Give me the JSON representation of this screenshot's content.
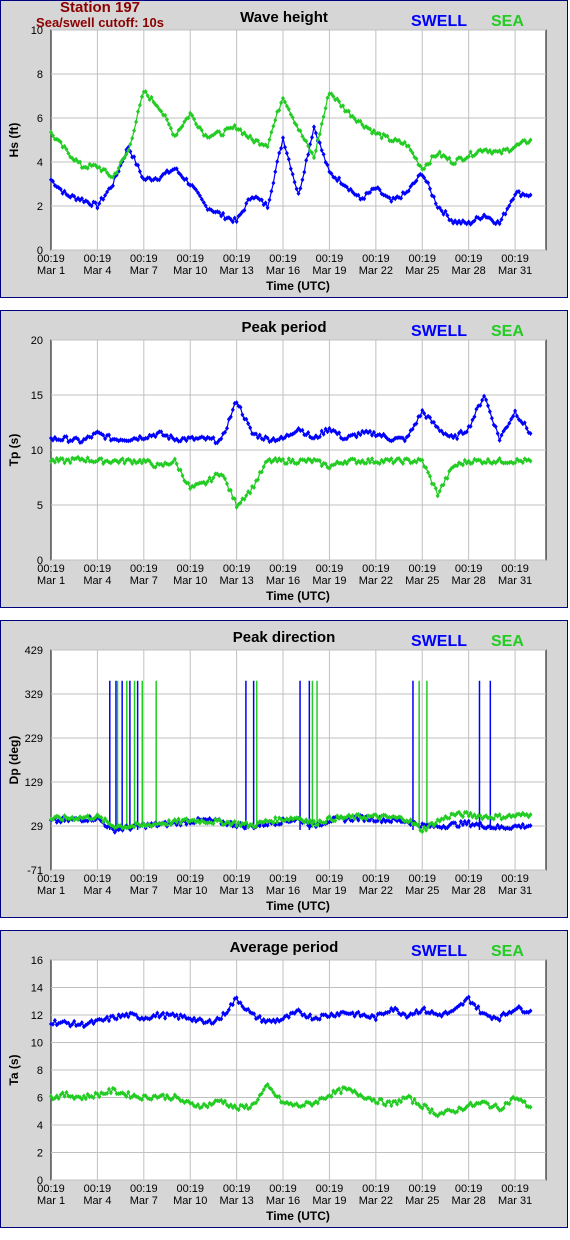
{
  "station": {
    "title": "Station 197",
    "subtitle": "Sea/swell cutoff: 10s"
  },
  "colors": {
    "swell": "#0000ff",
    "sea": "#22cc22",
    "frame_bg": "#d6d6d6",
    "border": "#00007f",
    "grid": "#c0c0c0"
  },
  "chart_data": [
    {
      "type": "line",
      "title": "Wave height",
      "ylabel": "Hs (ft)",
      "xlabel": "Time (UTC)",
      "ylim": [
        0,
        10
      ],
      "yticks": [
        "0",
        "2",
        "4",
        "6",
        "8",
        "10"
      ],
      "xticks": [
        [
          "00:19",
          "Mar 1"
        ],
        [
          "00:19",
          "Mar 4"
        ],
        [
          "00:19",
          "Mar 7"
        ],
        [
          "00:19",
          "Mar 10"
        ],
        [
          "00:19",
          "Mar 13"
        ],
        [
          "00:19",
          "Mar 16"
        ],
        [
          "00:19",
          "Mar 19"
        ],
        [
          "00:19",
          "Mar 22"
        ],
        [
          "00:19",
          "Mar 25"
        ],
        [
          "00:19",
          "Mar 28"
        ],
        [
          "00:19",
          "Mar 31"
        ]
      ],
      "legend": [
        "SWELL",
        "SEA"
      ],
      "x_days": [
        0,
        1,
        2,
        3,
        4,
        5,
        6,
        7,
        8,
        9,
        10,
        11,
        12,
        13,
        14,
        15,
        16,
        17,
        18,
        19,
        20,
        21,
        22,
        23,
        24,
        25,
        26,
        27,
        28,
        29,
        30,
        31
      ],
      "series": [
        {
          "name": "SWELL",
          "values": [
            3.2,
            2.5,
            2.3,
            2.0,
            3.0,
            4.7,
            3.2,
            3.3,
            3.7,
            3.0,
            2.0,
            1.6,
            1.3,
            2.5,
            2.0,
            5.1,
            2.5,
            5.6,
            3.5,
            3.0,
            2.3,
            2.8,
            2.2,
            2.6,
            3.5,
            2.0,
            1.3,
            1.2,
            1.6,
            1.2,
            2.6,
            2.5
          ]
        },
        {
          "name": "SEA",
          "values": [
            5.3,
            4.5,
            3.8,
            3.8,
            3.3,
            4.5,
            7.2,
            6.5,
            5.2,
            6.2,
            5.2,
            5.3,
            5.6,
            5.0,
            4.8,
            7.0,
            5.5,
            4.2,
            7.2,
            6.4,
            5.8,
            5.3,
            5.0,
            4.8,
            3.7,
            4.4,
            4.0,
            4.3,
            4.6,
            4.4,
            4.7,
            5.0
          ]
        }
      ]
    },
    {
      "type": "line",
      "title": "Peak period",
      "ylabel": "Tp (s)",
      "xlabel": "Time (UTC)",
      "ylim": [
        0,
        20
      ],
      "yticks": [
        "0",
        "5",
        "10",
        "15",
        "20"
      ],
      "xticks": [
        [
          "00:19",
          "Mar 1"
        ],
        [
          "00:19",
          "Mar 4"
        ],
        [
          "00:19",
          "Mar 7"
        ],
        [
          "00:19",
          "Mar 10"
        ],
        [
          "00:19",
          "Mar 13"
        ],
        [
          "00:19",
          "Mar 16"
        ],
        [
          "00:19",
          "Mar 19"
        ],
        [
          "00:19",
          "Mar 22"
        ],
        [
          "00:19",
          "Mar 25"
        ],
        [
          "00:19",
          "Mar 28"
        ],
        [
          "00:19",
          "Mar 31"
        ]
      ],
      "legend": [
        "SWELL",
        "SEA"
      ],
      "x_days": [
        0,
        1,
        2,
        3,
        4,
        5,
        6,
        7,
        8,
        9,
        10,
        11,
        12,
        13,
        14,
        15,
        16,
        17,
        18,
        19,
        20,
        21,
        22,
        23,
        24,
        25,
        26,
        27,
        28,
        29,
        30,
        31
      ],
      "series": [
        {
          "name": "SWELL",
          "values": [
            11.0,
            11.0,
            10.8,
            11.5,
            11.0,
            11.0,
            11.2,
            11.5,
            11.0,
            11.0,
            11.0,
            10.8,
            14.5,
            11.5,
            11.0,
            11.0,
            12.0,
            11.0,
            12.0,
            11.0,
            11.5,
            11.5,
            11.0,
            11.0,
            13.5,
            12.0,
            11.0,
            12.0,
            15.0,
            11.0,
            13.5,
            11.5
          ]
        },
        {
          "name": "SEA",
          "values": [
            9.0,
            9.0,
            9.2,
            9.0,
            9.0,
            9.0,
            9.0,
            8.5,
            9.0,
            6.5,
            7.0,
            8.0,
            5.0,
            6.5,
            9.0,
            9.0,
            9.0,
            9.0,
            8.5,
            9.0,
            9.0,
            9.0,
            9.0,
            9.0,
            9.0,
            6.0,
            8.5,
            9.0,
            9.0,
            9.0,
            9.0,
            9.0
          ]
        }
      ]
    },
    {
      "type": "line",
      "title": "Peak direction",
      "ylabel": "Dp (deg)",
      "xlabel": "Time (UTC)",
      "ylim": [
        -71,
        429
      ],
      "yticks": [
        "-71",
        "29",
        "129",
        "229",
        "329",
        "429"
      ],
      "xticks": [
        [
          "00:19",
          "Mar 1"
        ],
        [
          "00:19",
          "Mar 4"
        ],
        [
          "00:19",
          "Mar 7"
        ],
        [
          "00:19",
          "Mar 10"
        ],
        [
          "00:19",
          "Mar 13"
        ],
        [
          "00:19",
          "Mar 16"
        ],
        [
          "00:19",
          "Mar 19"
        ],
        [
          "00:19",
          "Mar 22"
        ],
        [
          "00:19",
          "Mar 25"
        ],
        [
          "00:19",
          "Mar 28"
        ],
        [
          "00:19",
          "Mar 31"
        ]
      ],
      "legend": [
        "SWELL",
        "SEA"
      ],
      "x_days": [
        0,
        1,
        2,
        3,
        4,
        5,
        6,
        7,
        8,
        9,
        10,
        11,
        12,
        13,
        14,
        15,
        16,
        17,
        18,
        19,
        20,
        21,
        22,
        23,
        24,
        25,
        26,
        27,
        28,
        29,
        30,
        31
      ],
      "series": [
        {
          "name": "SWELL",
          "values": [
            40,
            42,
            45,
            47,
            20,
            25,
            30,
            32,
            35,
            40,
            42,
            38,
            32,
            28,
            35,
            40,
            45,
            30,
            42,
            45,
            47,
            45,
            42,
            40,
            30,
            28,
            32,
            35,
            30,
            25,
            28,
            30
          ]
        },
        {
          "name": "SEA",
          "values": [
            45,
            47,
            48,
            50,
            30,
            28,
            30,
            35,
            38,
            42,
            40,
            38,
            35,
            30,
            40,
            45,
            48,
            35,
            45,
            48,
            50,
            50,
            48,
            45,
            20,
            40,
            55,
            55,
            50,
            50,
            52,
            55
          ]
        }
      ],
      "spikes": {
        "swell_days": [
          3.8,
          4.2,
          4.6,
          5.1,
          5.6,
          12.6,
          13.1,
          16.1,
          16.7,
          23.4,
          27.7,
          28.4
        ],
        "sea_days": [
          4.3,
          4.9,
          5.4,
          5.9,
          6.8,
          13.3,
          16.9,
          17.2,
          23.8,
          24.3
        ],
        "level": 359
      }
    },
    {
      "type": "line",
      "title": "Average period",
      "ylabel": "Ta (s)",
      "xlabel": "Time (UTC)",
      "ylim": [
        0,
        16
      ],
      "yticks": [
        "0",
        "2",
        "4",
        "6",
        "8",
        "10",
        "12",
        "14",
        "16"
      ],
      "xticks": [
        [
          "00:19",
          "Mar 1"
        ],
        [
          "00:19",
          "Mar 4"
        ],
        [
          "00:19",
          "Mar 7"
        ],
        [
          "00:19",
          "Mar 10"
        ],
        [
          "00:19",
          "Mar 13"
        ],
        [
          "00:19",
          "Mar 16"
        ],
        [
          "00:19",
          "Mar 19"
        ],
        [
          "00:19",
          "Mar 22"
        ],
        [
          "00:19",
          "Mar 25"
        ],
        [
          "00:19",
          "Mar 28"
        ],
        [
          "00:19",
          "Mar 31"
        ]
      ],
      "legend": [
        "SWELL",
        "SEA"
      ],
      "x_days": [
        0,
        1,
        2,
        3,
        4,
        5,
        6,
        7,
        8,
        9,
        10,
        11,
        12,
        13,
        14,
        15,
        16,
        17,
        18,
        19,
        20,
        21,
        22,
        23,
        24,
        25,
        26,
        27,
        28,
        29,
        30,
        31
      ],
      "series": [
        {
          "name": "SWELL",
          "values": [
            11.5,
            11.4,
            11.3,
            11.5,
            11.8,
            12.0,
            11.8,
            12.0,
            11.9,
            11.8,
            11.4,
            11.8,
            13.2,
            12.0,
            11.5,
            11.7,
            12.2,
            11.8,
            12.0,
            12.2,
            12.0,
            11.8,
            12.5,
            12.0,
            12.4,
            12.0,
            12.2,
            13.2,
            12.0,
            11.8,
            12.5,
            12.3
          ]
        },
        {
          "name": "SEA",
          "values": [
            6.0,
            6.2,
            6.0,
            6.2,
            6.5,
            6.2,
            6.0,
            6.1,
            6.0,
            5.5,
            5.4,
            5.8,
            5.2,
            5.4,
            6.8,
            5.6,
            5.4,
            5.6,
            6.2,
            6.6,
            6.2,
            5.8,
            5.5,
            6.0,
            5.4,
            4.8,
            5.0,
            5.4,
            5.6,
            5.2,
            6.0,
            5.3
          ]
        }
      ]
    }
  ]
}
